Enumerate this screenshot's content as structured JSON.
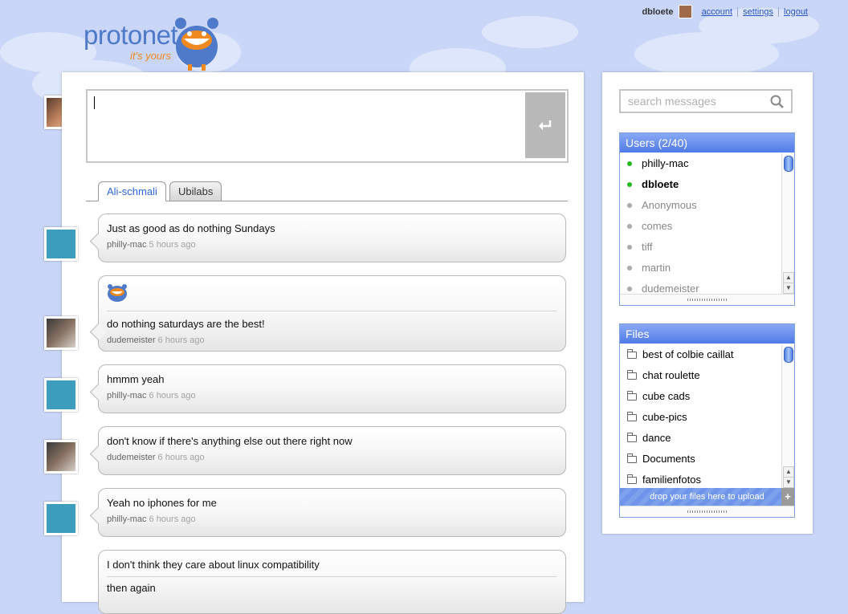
{
  "brand": {
    "name": "protonet",
    "tagline": "it's yours"
  },
  "topnav": {
    "username": "dbloete",
    "links": [
      "account",
      "settings",
      "logout"
    ]
  },
  "composer": {
    "value": "",
    "send_icon": "return-arrow-icon"
  },
  "tabs": [
    {
      "label": "Ali-schmali",
      "active": true
    },
    {
      "label": "Ubilabs",
      "active": false
    }
  ],
  "messages": [
    {
      "lines": [
        "Just as good as do nothing Sundays"
      ],
      "author": "philly-mac",
      "time": "5 hours ago"
    },
    {
      "has_emoticon": true,
      "lines": [
        "do nothing saturdays are the best!"
      ],
      "author": "dudemeister",
      "time": "6 hours ago"
    },
    {
      "lines": [
        "hmmm yeah"
      ],
      "author": "philly-mac",
      "time": "6 hours ago"
    },
    {
      "lines": [
        "don't know if there's anything else out there right now"
      ],
      "author": "dudemeister",
      "time": "6 hours ago"
    },
    {
      "lines": [
        "Yeah no iphones for me"
      ],
      "author": "philly-mac",
      "time": "6 hours ago"
    },
    {
      "lines": [
        "I don't think they care about linux compatibility",
        "then again"
      ]
    }
  ],
  "search": {
    "placeholder": "search messages"
  },
  "users": {
    "title": "Users (2/40)",
    "items": [
      {
        "name": "philly-mac",
        "online": true
      },
      {
        "name": "dbloete",
        "online": true,
        "me": true
      },
      {
        "name": "Anonymous",
        "online": false
      },
      {
        "name": "comes",
        "online": false
      },
      {
        "name": "tiff",
        "online": false
      },
      {
        "name": "martin",
        "online": false
      },
      {
        "name": "dudemeister",
        "online": false
      }
    ]
  },
  "files": {
    "title": "Files",
    "items": [
      "best of colbie caillat",
      "chat roulette",
      "cube cads",
      "cube-pics",
      "dance",
      "Documents",
      "familienfotos"
    ],
    "drop_label": "drop your files here to upload",
    "add_label": "+"
  },
  "colors": {
    "accent": "#4f7ae8",
    "online": "#1fbb1f",
    "logo_blue": "#4f79c9",
    "logo_orange": "#f08a1e"
  }
}
